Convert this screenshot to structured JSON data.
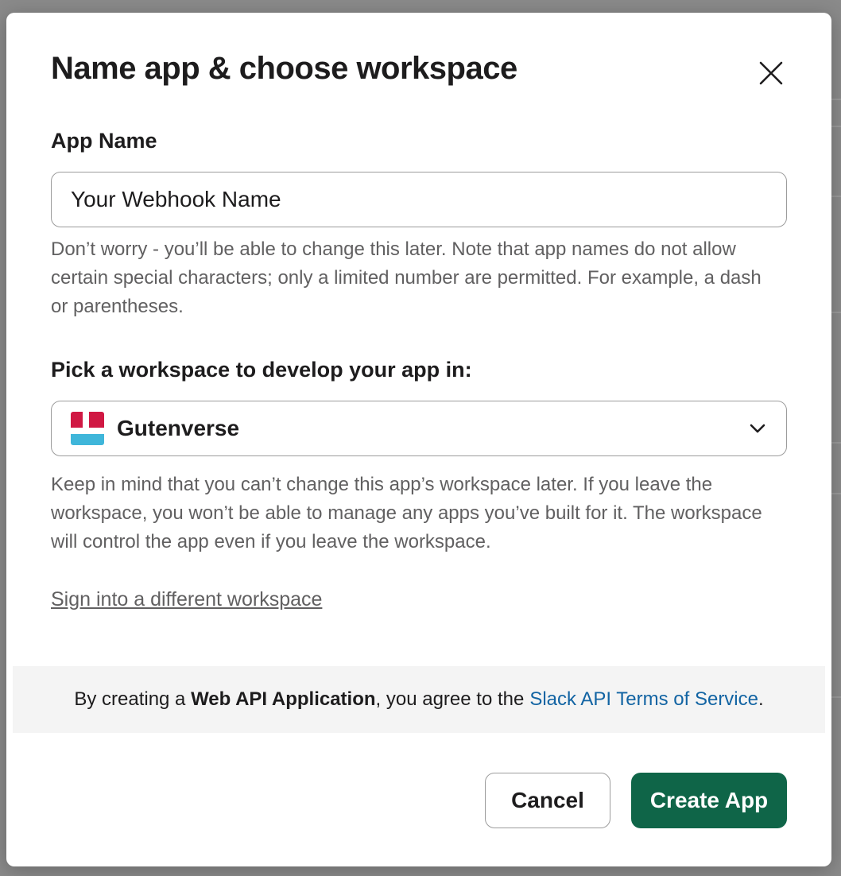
{
  "modal": {
    "title": "Name app & choose workspace",
    "close_icon": "close-icon"
  },
  "app_name": {
    "label": "App Name",
    "value": "Your Webhook Name",
    "help": "Don’t worry - you’ll be able to change this later. Note that app names do not allow certain special characters; only a limited number are permitted. For example, a dash or parentheses."
  },
  "workspace": {
    "label": "Pick a workspace to develop your app in:",
    "selected": "Gutenverse",
    "logo_colors": [
      "#d01843",
      "#3fb6da"
    ],
    "help": "Keep in mind that you can’t change this app’s workspace later. If you leave the workspace, you won’t be able to manage any apps you’ve built for it. The workspace will control the app even if you leave the workspace.",
    "sign_in_link": "Sign into a different workspace"
  },
  "terms": {
    "prefix": "By creating a ",
    "bold": "Web API Application",
    "middle": ", you agree to the",
    "link": "Slack API Terms of Service",
    "suffix": "."
  },
  "buttons": {
    "cancel": "Cancel",
    "create": "Create App"
  },
  "colors": {
    "primary_button": "#0f6548",
    "link": "#1264a3"
  }
}
